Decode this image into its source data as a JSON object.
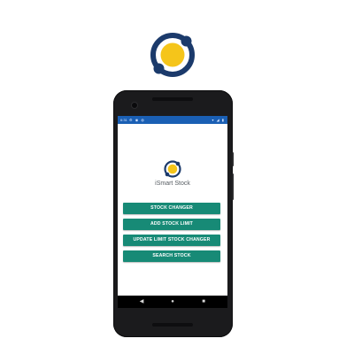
{
  "colors": {
    "logo_ring": "#1b3a6b",
    "logo_sun": "#f5c51a",
    "status_bar": "#1a5fb4",
    "button_bg": "#178a76",
    "button_text": "#ffffff",
    "phone_body": "#1b1b1d"
  },
  "status_bar": {
    "time": "6:31",
    "left_icons": [
      "settings-icon",
      "sync-icon",
      "notification-icon"
    ],
    "right_icons": [
      "wifi-icon",
      "signal-icon",
      "battery-icon"
    ]
  },
  "app": {
    "logo_icon": "orbit-sun-logo",
    "name": "iSmart Stock"
  },
  "menu": {
    "buttons": [
      {
        "label": "STOCK CHANGER"
      },
      {
        "label": "ADD STOCK LIMIT"
      },
      {
        "label": "UPDATE LIMIT STOCK CHANGER"
      },
      {
        "label": "SEARCH STOCK"
      }
    ]
  },
  "nav_bar": {
    "back_icon": "back-triangle-icon",
    "home_icon": "home-circle-icon",
    "recents_icon": "recents-square-icon"
  }
}
